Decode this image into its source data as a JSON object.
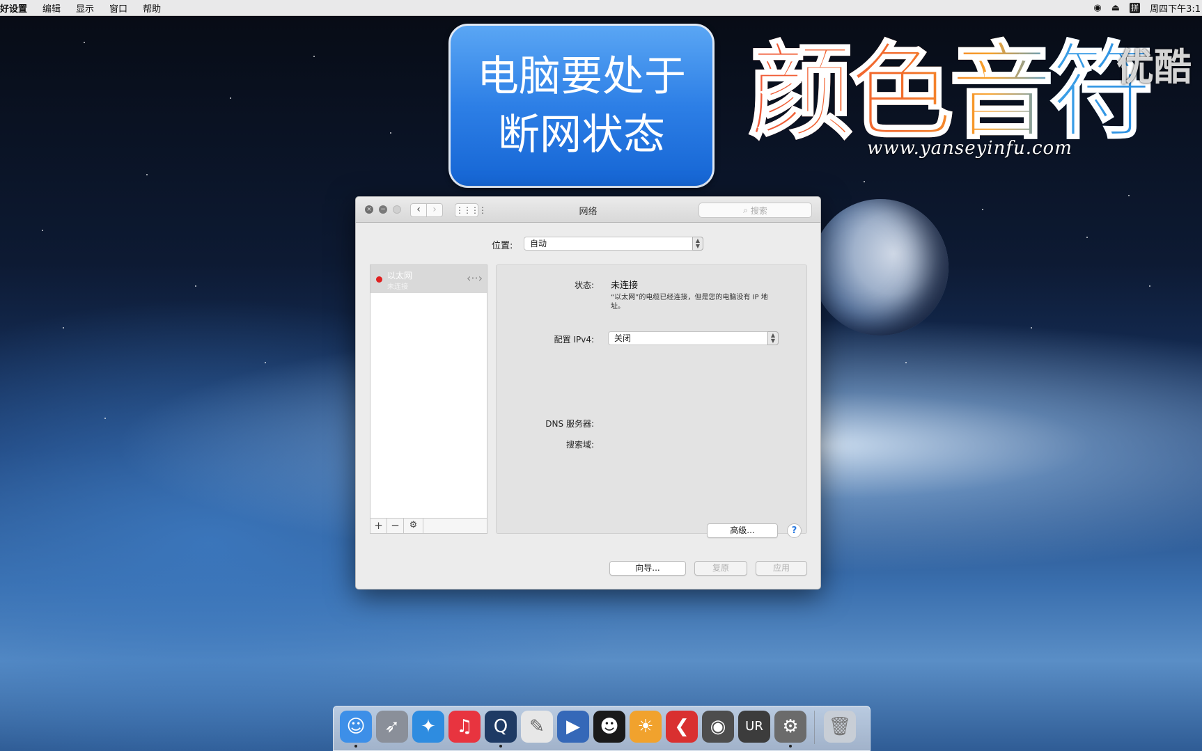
{
  "menubar": {
    "items": [
      "好设置",
      "编辑",
      "显示",
      "窗口",
      "帮助"
    ],
    "ime_label": "拼",
    "clock": "周四下午3:1"
  },
  "callout": {
    "line1": "电脑要处于",
    "line2": "断网状态"
  },
  "logo": {
    "brand": "颜色音符",
    "url": "www.yanseyinfu.com",
    "watermark": "优酷"
  },
  "window": {
    "title": "网络",
    "search_placeholder": "搜索",
    "location_label": "位置:",
    "location_value": "自动",
    "services": [
      {
        "name": "以太网",
        "status": "未连接",
        "status_color": "#e02020"
      }
    ],
    "detail": {
      "status_label": "状态:",
      "status_value": "未连接",
      "status_desc": "“以太网”的电缆已经连接，但是您的电脑没有 IP 地址。",
      "ipv4_label": "配置 IPv4:",
      "ipv4_value": "关闭",
      "dns_label": "DNS 服务器:",
      "search_domain_label": "搜索域:"
    },
    "advanced_button": "高级...",
    "help_button": "?",
    "assist_button": "向导...",
    "revert_button": "复原",
    "apply_button": "应用",
    "toolbar": {
      "add": "+",
      "remove": "−",
      "gear": "⚙"
    }
  },
  "dock": {
    "items": [
      {
        "name": "finder",
        "glyph": "☺",
        "color": "#3d8fe8",
        "running": true
      },
      {
        "name": "launchpad",
        "glyph": "➶",
        "color": "#8a8f99",
        "running": false
      },
      {
        "name": "safari",
        "glyph": "✦",
        "color": "#2e8ce0",
        "running": false
      },
      {
        "name": "itunes",
        "glyph": "♫",
        "color": "#e8343f",
        "running": false
      },
      {
        "name": "quicktime",
        "glyph": "Q",
        "color": "#1e3a64",
        "running": true
      },
      {
        "name": "textedit",
        "glyph": "✎",
        "color": "#e7e7e7",
        "running": false
      },
      {
        "name": "media-player",
        "glyph": "▶",
        "color": "#3568b8",
        "running": false
      },
      {
        "name": "qq",
        "glyph": "☻",
        "color": "#1a1a1a",
        "running": false
      },
      {
        "name": "game-app",
        "glyph": "☀",
        "color": "#f1a22d",
        "running": false
      },
      {
        "name": "red-app",
        "glyph": "❮",
        "color": "#d93030",
        "running": false
      },
      {
        "name": "disk-utility",
        "glyph": "◉",
        "color": "#4d4d4d",
        "running": false
      },
      {
        "name": "ur44",
        "glyph": "UR",
        "color": "#3c3c3c",
        "running": false
      },
      {
        "name": "system-preferences",
        "glyph": "⚙",
        "color": "#6b6b6b",
        "running": true
      }
    ],
    "trash": {
      "name": "trash",
      "glyph": "🗑",
      "color": "#c8ced6"
    }
  }
}
